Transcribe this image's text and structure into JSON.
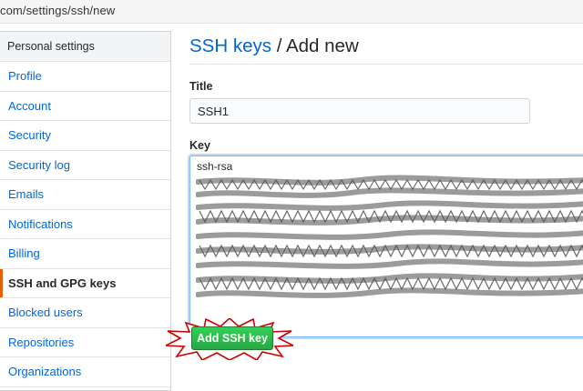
{
  "browser": {
    "url": "com/settings/ssh/new"
  },
  "sidebar": {
    "header": "Personal settings",
    "items": [
      {
        "label": "Profile",
        "selected": false
      },
      {
        "label": "Account",
        "selected": false
      },
      {
        "label": "Security",
        "selected": false
      },
      {
        "label": "Security log",
        "selected": false
      },
      {
        "label": "Emails",
        "selected": false
      },
      {
        "label": "Notifications",
        "selected": false
      },
      {
        "label": "Billing",
        "selected": false
      },
      {
        "label": "SSH and GPG keys",
        "selected": true
      },
      {
        "label": "Blocked users",
        "selected": false
      },
      {
        "label": "Repositories",
        "selected": false
      },
      {
        "label": "Organizations",
        "selected": false
      }
    ]
  },
  "main": {
    "breadcrumb_link": "SSH keys",
    "breadcrumb_separator": "/",
    "breadcrumb_current": "Add new",
    "title_label": "Title",
    "title_value": "SSH1",
    "key_label": "Key",
    "key_first_line": "ssh-rsa",
    "submit_label": "Add SSH key"
  },
  "colors": {
    "link": "#0366d6",
    "selected_indicator": "#e36209",
    "button_green": "#28a745",
    "starburst_red": "#cc0000"
  }
}
